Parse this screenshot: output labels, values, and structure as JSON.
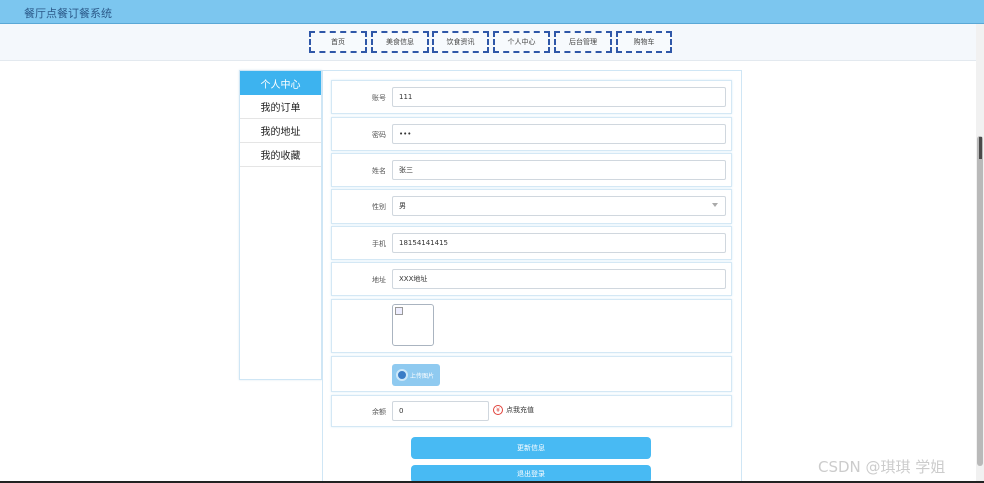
{
  "app_title": "餐厅点餐订餐系统",
  "nav": [
    "首页",
    "美食信息",
    "饮食资讯",
    "个人中心",
    "后台管理",
    "购物车"
  ],
  "sidebar": [
    "个人中心",
    "我的订单",
    "我的地址",
    "我的收藏"
  ],
  "form": {
    "account_label": "账号",
    "account_value": "111",
    "password_label": "密码",
    "password_value": "•••",
    "name_label": "姓名",
    "name_value": "张三",
    "gender_label": "性别",
    "gender_value": "男",
    "phone_label": "手机",
    "phone_value": "18154141415",
    "address_label": "地址",
    "address_value": "XXX地址",
    "upload_label": "上传图片",
    "balance_label": "余额",
    "balance_value": "0",
    "recharge_label": "点我充值"
  },
  "buttons": {
    "update": "更新信息",
    "logout": "退出登录"
  },
  "watermark": "CSDN @琪琪 学姐"
}
